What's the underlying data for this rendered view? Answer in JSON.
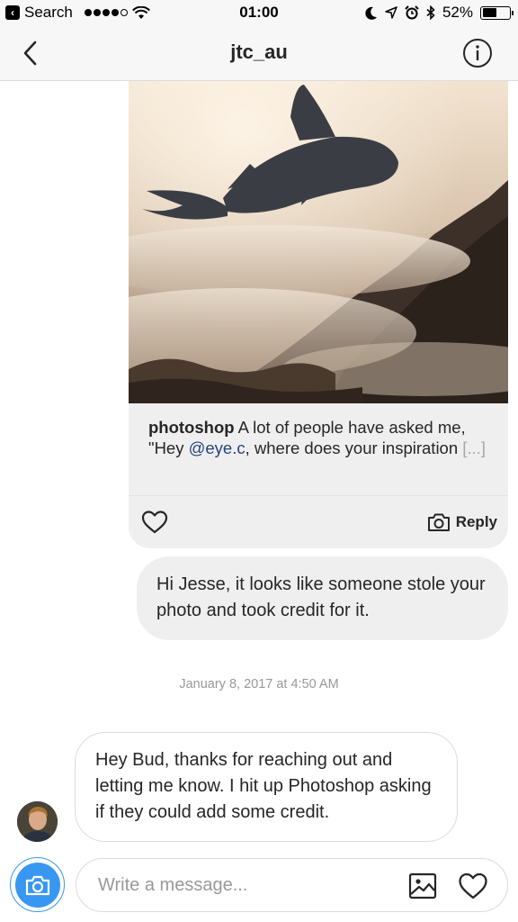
{
  "status_bar": {
    "back_app_label": "Search",
    "time": "01:00",
    "battery_percent": "52%",
    "battery_level": 0.52,
    "signal_bars": 4,
    "icons": [
      "wifi-icon",
      "moon-icon",
      "location-icon",
      "alarm-icon",
      "bluetooth-icon",
      "battery-icon"
    ]
  },
  "nav": {
    "title": "jtc_au",
    "back_icon": "chevron-left-icon",
    "info_icon": "info-icon"
  },
  "shared_post": {
    "username": "photoshop",
    "caption_part1": " A lot of people have asked me, \"Hey ",
    "mention": "@eye.c",
    "caption_part2": ", where does your inspiration ",
    "more": "[...]",
    "reply_label": "Reply",
    "like_icon": "heart-icon",
    "reply_icon": "camera-icon"
  },
  "messages": [
    {
      "direction": "outgoing",
      "text": "Hi Jesse, it looks like someone stole your photo and took credit for it."
    },
    {
      "direction": "incoming",
      "text": "Hey Bud, thanks for reaching out and letting me know. I hit up Photoshop asking if they could add some credit."
    }
  ],
  "timestamp": "January 8, 2017 at 4:50 AM",
  "composer": {
    "placeholder": "Write a message...",
    "camera_icon": "camera-icon",
    "gallery_icon": "image-icon",
    "like_icon": "heart-icon"
  },
  "colors": {
    "accent": "#3897f0",
    "mention": "#27437e",
    "bubble_grey": "#efefef",
    "nav_bg": "#f7f7f7"
  }
}
